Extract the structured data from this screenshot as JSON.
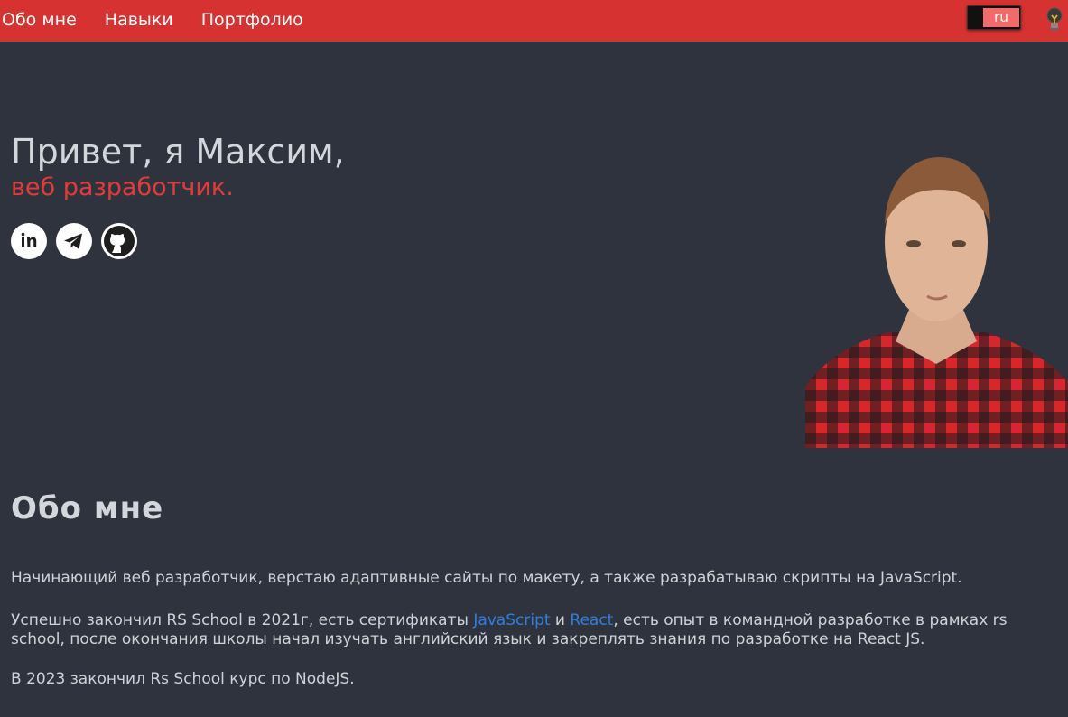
{
  "nav": {
    "items": [
      {
        "label": "Обо мне"
      },
      {
        "label": "Навыки"
      },
      {
        "label": "Портфолио"
      }
    ],
    "lang": "ru",
    "theme_icon": "lightbulb-icon"
  },
  "hero": {
    "greeting": "Привет, я Максим,",
    "role": "веб разработчик.",
    "social": [
      "linkedin-icon",
      "telegram-icon",
      "github-icon"
    ]
  },
  "about": {
    "title": "Обо мне",
    "p1": "Начинающий веб разработчик, верстаю адаптивные сайты по макету, а также разрабатываю скрипты на JavaScript.",
    "p2_pre": "Успешно закончил RS School в 2021г, есть сертификаты ",
    "link_js": "JavaScript",
    "p2_and": " и ",
    "link_react": "React",
    "p2_post": ", есть опыт в командной разработке в рамках rs school, после окончания школы начал изучать английский язык и закреплять знания по разработке на React JS.",
    "p3": "В 2023 закончил Rs School курс по NodeJS."
  },
  "colors": {
    "header_bg": "#d63232",
    "page_bg": "#2f333d",
    "accent": "#e23b3b",
    "link": "#2f7fe0"
  }
}
